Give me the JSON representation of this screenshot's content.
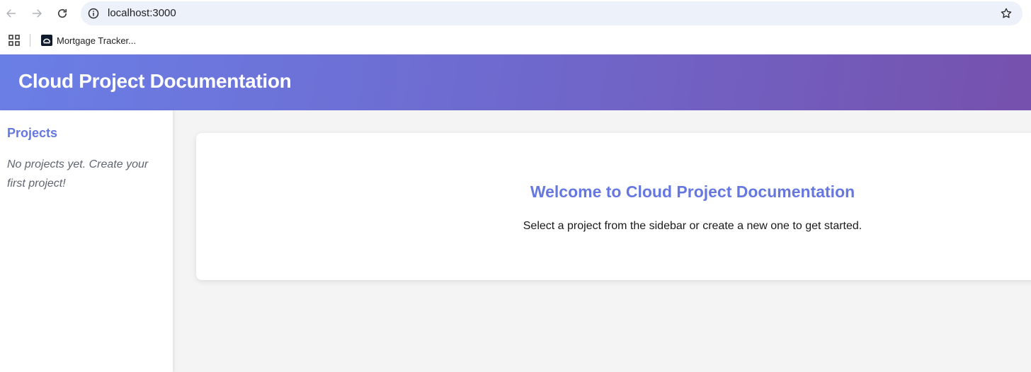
{
  "browser": {
    "url": "localhost:3000",
    "icons": {
      "back": "arrow-left-icon",
      "forward": "arrow-right-icon",
      "reload": "reload-icon",
      "site_info": "info-icon",
      "bookmark": "star-icon",
      "apps": "apps-grid-icon"
    }
  },
  "bookmarks": {
    "items": [
      {
        "label": "Mortgage Tracker..."
      }
    ]
  },
  "header": {
    "title": "Cloud Project Documentation"
  },
  "sidebar": {
    "title": "Projects",
    "empty_message": "No projects yet. Create your first project!"
  },
  "main": {
    "welcome_title": "Welcome to Cloud Project Documentation",
    "welcome_text": "Select a project from the sidebar or create a new one to get started."
  },
  "colors": {
    "accent": "#6678e0",
    "header_gradient_start": "#6a7fe6",
    "header_gradient_end": "#7651ad",
    "page_background": "#f4f4f5"
  }
}
